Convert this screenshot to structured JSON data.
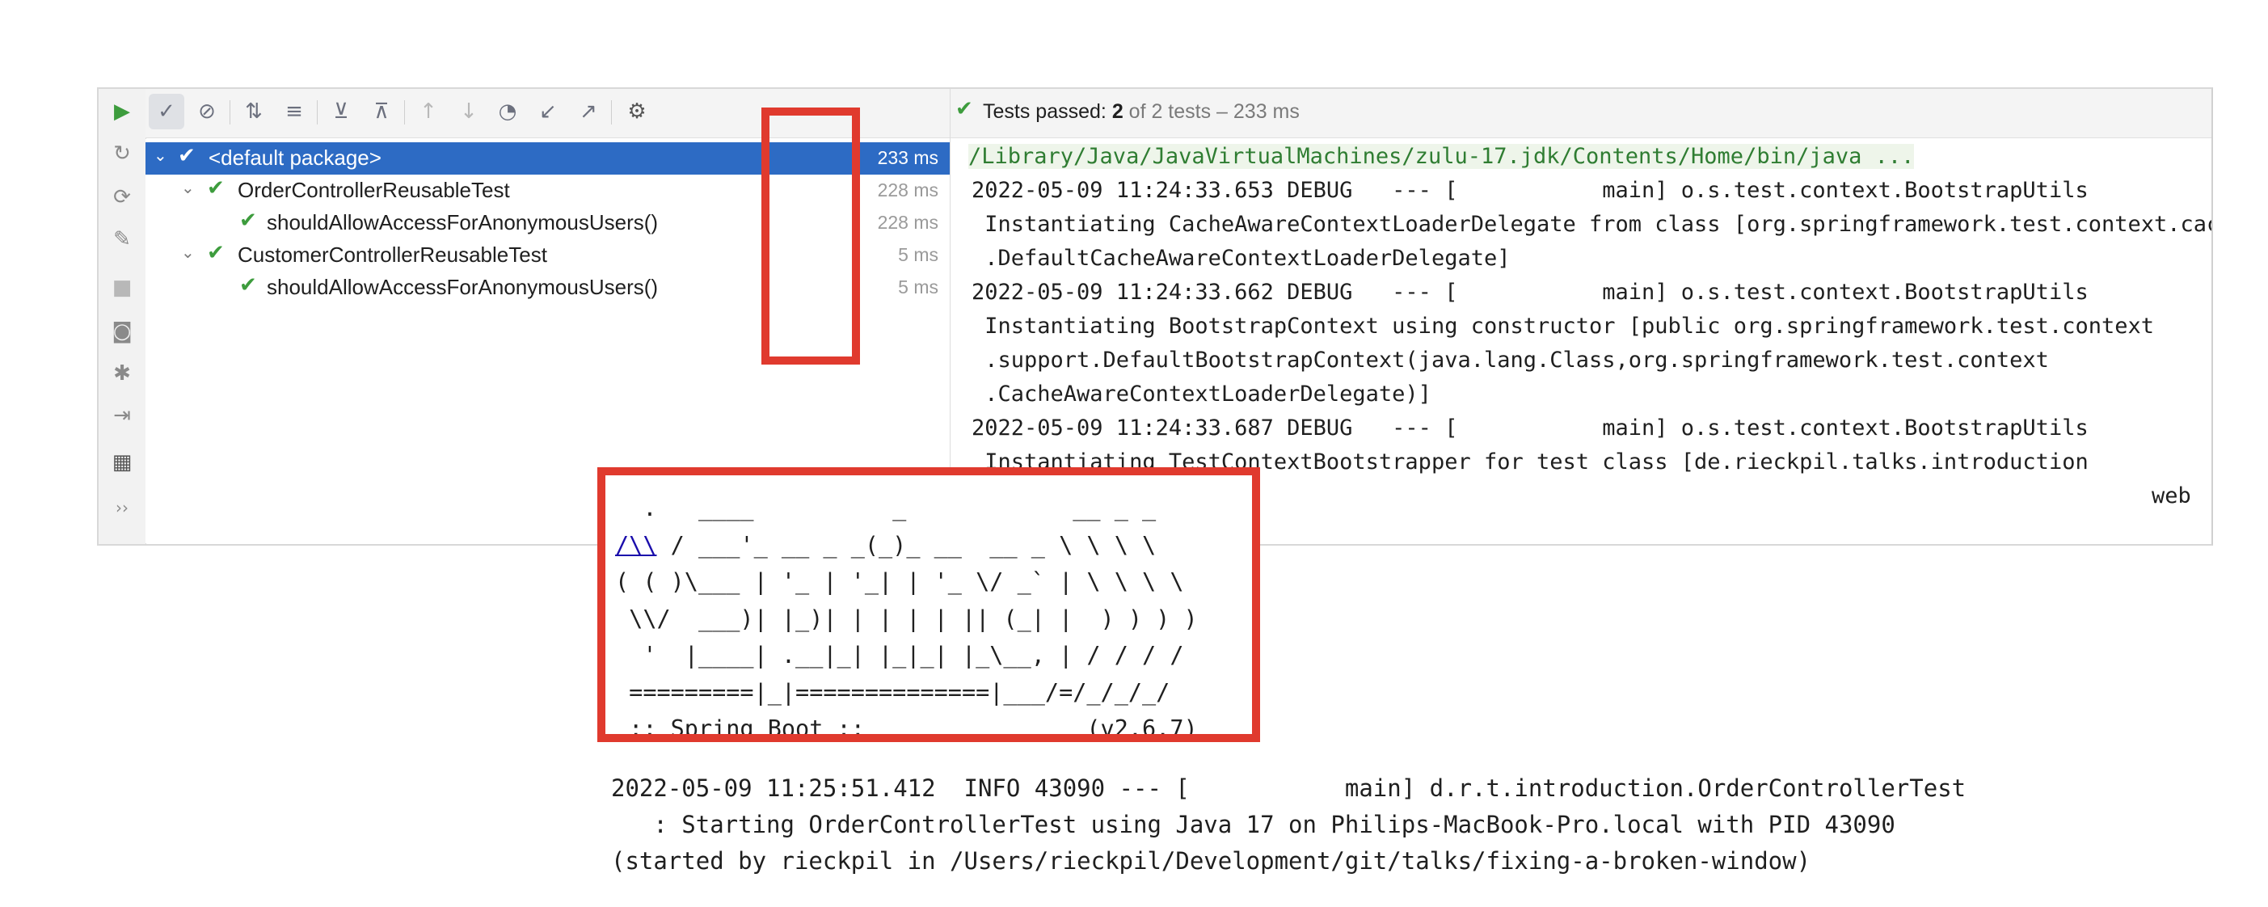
{
  "toolbar": {
    "icons": [
      "run-icon",
      "check-icon",
      "cancel-icon",
      "sort-alpha-icon",
      "sort-duration-icon",
      "expand-all-icon",
      "collapse-all-icon",
      "prev-failed-icon",
      "next-failed-icon",
      "history-icon",
      "import-icon",
      "export-icon",
      "settings-icon"
    ]
  },
  "left_strip": {
    "icons": [
      "rerun-failed-icon",
      "toggle-auto-test-icon",
      "wrench-icon",
      "stop-icon",
      "camera-icon",
      "debug-icon",
      "exit-icon",
      "layout-icon",
      "more-icon"
    ],
    "more_label": "››"
  },
  "tree": {
    "rows": [
      {
        "label": "<default package>",
        "time": "233 ms"
      },
      {
        "label": "OrderControllerReusableTest",
        "time": "228 ms"
      },
      {
        "label": "shouldAllowAccessForAnonymousUsers()",
        "time": "228 ms"
      },
      {
        "label": "CustomerControllerReusableTest",
        "time": "5 ms"
      },
      {
        "label": "shouldAllowAccessForAnonymousUsers()",
        "time": "5 ms"
      }
    ]
  },
  "status": {
    "passed_label": "Tests passed: ",
    "passed_count": "2",
    "rest": " of 2 tests – 233 ms"
  },
  "console": {
    "lines": [
      "/Library/Java/JavaVirtualMachines/zulu-17.jdk/Contents/Home/bin/java ...",
      "2022-05-09 11:24:33.653 DEBUG   --- [           main] o.s.test.context.BootstrapUtils          :",
      " Instantiating CacheAwareContextLoaderDelegate from class [org.springframework.test.context.cache",
      " .DefaultCacheAwareContextLoaderDelegate]",
      "2022-05-09 11:24:33.662 DEBUG   --- [           main] o.s.test.context.BootstrapUtils          :",
      " Instantiating BootstrapContext using constructor [public org.springframework.test.context",
      " .support.DefaultBootstrapContext(java.lang.Class,org.springframework.test.context",
      " .CacheAwareContextLoaderDelegate)]",
      "2022-05-09 11:24:33.687 DEBUG   --- [           main] o.s.test.context.BootstrapUtils          :",
      " Instantiating TestContextBootstrapper for test class [de.rieckpil.talks.introduction"
    ],
    "overflow_tail": "web"
  },
  "banner": {
    "line1": "  .   ____          _            __ _ _",
    "link": "/\\\\",
    "line2_rest": " / ___'_ __ _ _(_)_ __  __ _ \\ \\ \\ \\",
    "line3": "( ( )\\___ | '_ | '_| | '_ \\/ _` | \\ \\ \\ \\",
    "line4": " \\\\/  ___)| |_)| | | | | || (_| |  ) ) ) )",
    "line5": "  '  |____| .__|_| |_|_| |_\\__, | / / / /",
    "line6": " =========|_|==============|___/=/_/_/_/",
    "line7": " :: Spring Boot ::                (v2.6.7)"
  },
  "footer": {
    "line1": "2022-05-09 11:25:51.412  INFO 43090 --- [           main] d.r.t.introduction.OrderControllerTest",
    "line2": "   : Starting OrderControllerTest using Java 17 on Philips-MacBook-Pro.local with PID 43090",
    "line3": "(started by rieckpil in /Users/rieckpil/Development/git/talks/fixing-a-broken-window)"
  }
}
